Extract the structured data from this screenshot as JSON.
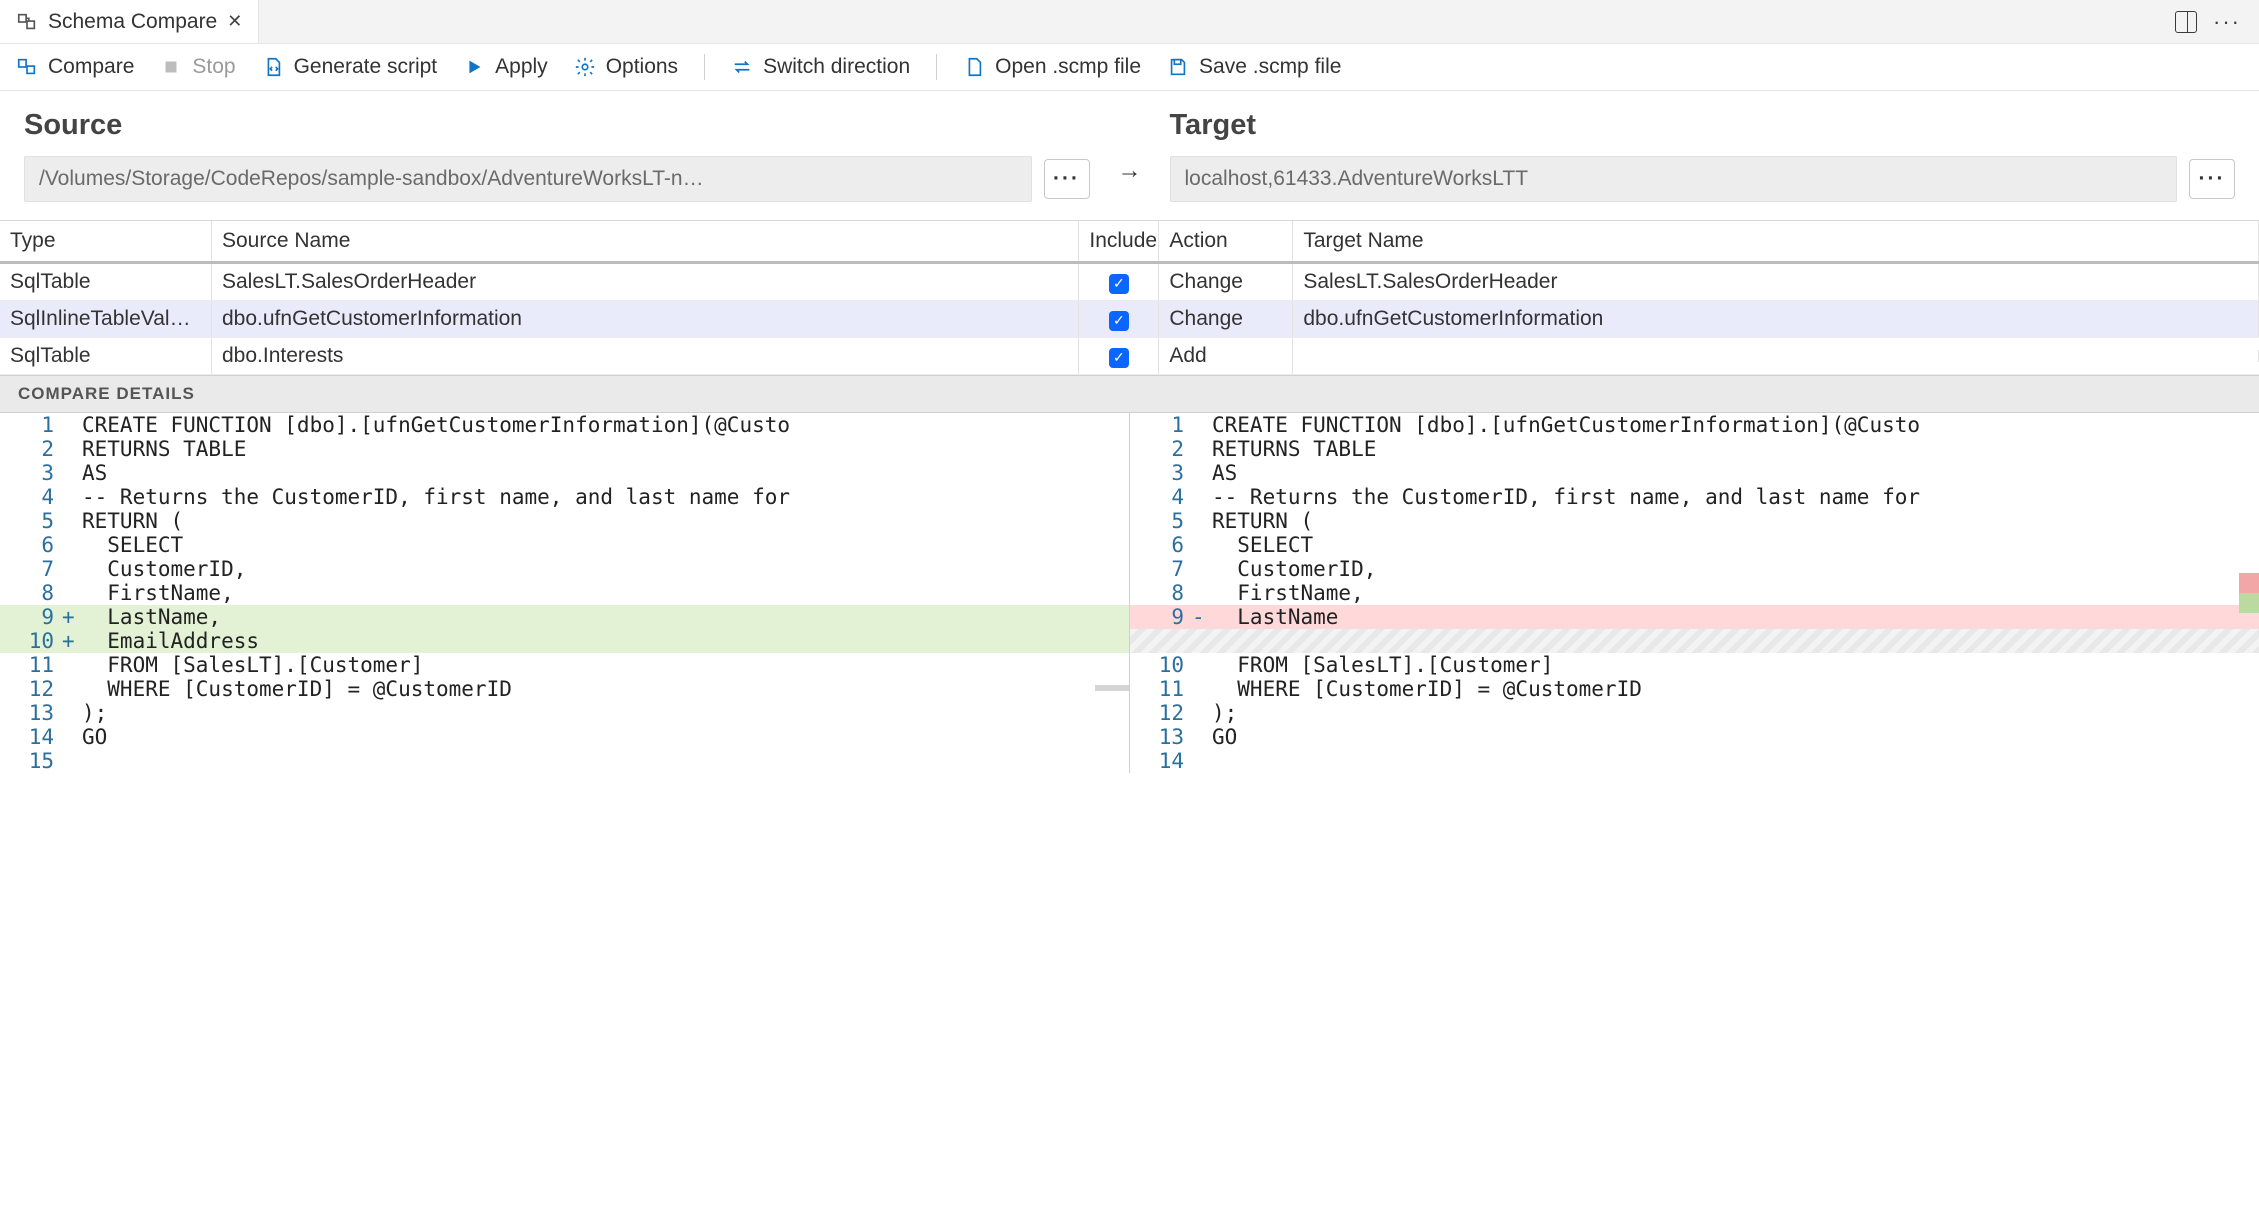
{
  "tab": {
    "title": "Schema Compare"
  },
  "toolbar": {
    "compare": "Compare",
    "stop": "Stop",
    "generate": "Generate script",
    "apply": "Apply",
    "options": "Options",
    "switch": "Switch direction",
    "open": "Open .scmp file",
    "save": "Save .scmp file"
  },
  "source": {
    "heading": "Source",
    "value": "/Volumes/Storage/CodeRepos/sample-sandbox/AdventureWorksLT-n…"
  },
  "target": {
    "heading": "Target",
    "value": "localhost,61433.AdventureWorksLTT"
  },
  "grid": {
    "headers": {
      "type": "Type",
      "source": "Source Name",
      "include": "Include",
      "action": "Action",
      "target": "Target Name"
    },
    "rows": [
      {
        "type": "SqlTable",
        "source": "SalesLT.SalesOrderHeader",
        "include": true,
        "action": "Change",
        "target": "SalesLT.SalesOrderHeader",
        "selected": false
      },
      {
        "type": "SqlInlineTableValuedFu…",
        "source": "dbo.ufnGetCustomerInformation",
        "include": true,
        "action": "Change",
        "target": "dbo.ufnGetCustomerInformation",
        "selected": true
      },
      {
        "type": "SqlTable",
        "source": "dbo.Interests",
        "include": true,
        "action": "Add",
        "target": "",
        "selected": false
      }
    ]
  },
  "details": {
    "heading": "COMPARE DETAILS"
  },
  "diff": {
    "left": [
      {
        "n": "1",
        "s": " ",
        "t": "CREATE FUNCTION [dbo].[ufnGetCustomerInformation](@Custo",
        "cls": ""
      },
      {
        "n": "2",
        "s": " ",
        "t": "RETURNS TABLE",
        "cls": ""
      },
      {
        "n": "3",
        "s": " ",
        "t": "AS",
        "cls": ""
      },
      {
        "n": "4",
        "s": " ",
        "t": "-- Returns the CustomerID, first name, and last name for",
        "cls": ""
      },
      {
        "n": "5",
        "s": " ",
        "t": "RETURN (",
        "cls": ""
      },
      {
        "n": "6",
        "s": " ",
        "t": "  SELECT",
        "cls": ""
      },
      {
        "n": "7",
        "s": " ",
        "t": "  CustomerID,",
        "cls": ""
      },
      {
        "n": "8",
        "s": " ",
        "t": "  FirstName,",
        "cls": ""
      },
      {
        "n": "9",
        "s": "+",
        "t": "  LastName,",
        "cls": "add"
      },
      {
        "n": "10",
        "s": "+",
        "t": "  EmailAddress",
        "cls": "add"
      },
      {
        "n": "11",
        "s": " ",
        "t": "  FROM [SalesLT].[Customer]",
        "cls": ""
      },
      {
        "n": "12",
        "s": " ",
        "t": "  WHERE [CustomerID] = @CustomerID",
        "cls": ""
      },
      {
        "n": "13",
        "s": " ",
        "t": ");",
        "cls": ""
      },
      {
        "n": "14",
        "s": " ",
        "t": "GO",
        "cls": ""
      },
      {
        "n": "15",
        "s": " ",
        "t": "",
        "cls": ""
      }
    ],
    "right": [
      {
        "n": "1",
        "s": " ",
        "t": "CREATE FUNCTION [dbo].[ufnGetCustomerInformation](@Custo",
        "cls": ""
      },
      {
        "n": "2",
        "s": " ",
        "t": "RETURNS TABLE",
        "cls": ""
      },
      {
        "n": "3",
        "s": " ",
        "t": "AS",
        "cls": ""
      },
      {
        "n": "4",
        "s": " ",
        "t": "-- Returns the CustomerID, first name, and last name for",
        "cls": ""
      },
      {
        "n": "5",
        "s": " ",
        "t": "RETURN (",
        "cls": ""
      },
      {
        "n": "6",
        "s": " ",
        "t": "  SELECT",
        "cls": ""
      },
      {
        "n": "7",
        "s": " ",
        "t": "  CustomerID,",
        "cls": ""
      },
      {
        "n": "8",
        "s": " ",
        "t": "  FirstName,",
        "cls": ""
      },
      {
        "n": "9",
        "s": "-",
        "t": "  LastName",
        "cls": "del"
      },
      {
        "n": "",
        "s": " ",
        "t": " ",
        "cls": "gap"
      },
      {
        "n": "10",
        "s": " ",
        "t": "  FROM [SalesLT].[Customer]",
        "cls": ""
      },
      {
        "n": "11",
        "s": " ",
        "t": "  WHERE [CustomerID] = @CustomerID",
        "cls": ""
      },
      {
        "n": "12",
        "s": " ",
        "t": ");",
        "cls": ""
      },
      {
        "n": "13",
        "s": " ",
        "t": "GO",
        "cls": ""
      },
      {
        "n": "14",
        "s": " ",
        "t": "",
        "cls": ""
      }
    ]
  }
}
